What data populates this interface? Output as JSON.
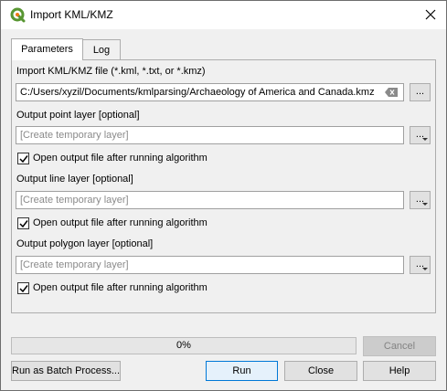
{
  "window": {
    "title": "Import KML/KMZ"
  },
  "tabs": [
    {
      "label": "Parameters",
      "active": true
    },
    {
      "label": "Log",
      "active": false
    }
  ],
  "params": {
    "input_label": "Import KML/KMZ file (*.kml, *.txt, or *.kmz)",
    "input_value": "C:/Users/xyzil/Documents/kmlparsing/Archaeology of America and Canada.kmz",
    "browse_label": "...",
    "point_label": "Output point layer [optional]",
    "point_placeholder": "[Create temporary layer]",
    "point_open_label": "Open output file after running algorithm",
    "point_open_checked": true,
    "line_label": "Output line layer [optional]",
    "line_placeholder": "[Create temporary layer]",
    "line_open_label": "Open output file after running algorithm",
    "line_open_checked": true,
    "polygon_label": "Output polygon layer [optional]",
    "polygon_placeholder": "[Create temporary layer]",
    "polygon_open_label": "Open output file after running algorithm",
    "polygon_open_checked": true
  },
  "progress": {
    "value": 0,
    "text": "0%"
  },
  "buttons": {
    "cancel": "Cancel",
    "batch": "Run as Batch Process...",
    "run": "Run",
    "close": "Close",
    "help": "Help"
  },
  "colors": {
    "accent": "#0078d7",
    "qgis_green": "#589632",
    "qgis_yellow": "#ee7913"
  }
}
